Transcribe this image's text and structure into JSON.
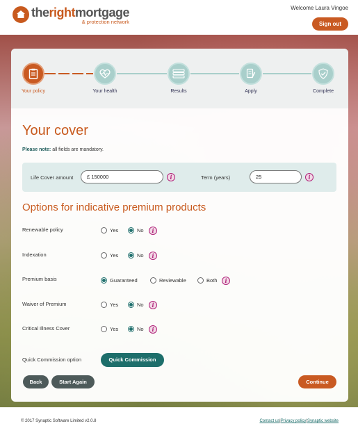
{
  "header": {
    "logo_the": "the",
    "logo_right": "right",
    "logo_mortgage": "mortgage",
    "logo_sub": "& protection network",
    "welcome": "Welcome Laura Vingoe",
    "signout": "Sign out"
  },
  "steps": [
    {
      "label": "Your policy",
      "icon": "clipboard-icon",
      "active": true
    },
    {
      "label": "Your health",
      "icon": "heart-pulse-icon",
      "active": false
    },
    {
      "label": "Results",
      "icon": "list-icon",
      "active": false
    },
    {
      "label": "Apply",
      "icon": "document-pen-icon",
      "active": false
    },
    {
      "label": "Complete",
      "icon": "shield-check-icon",
      "active": false
    }
  ],
  "cover": {
    "title": "Your cover",
    "note_bold": "Please note:",
    "note_text": " all fields are mandatory.",
    "life_cover_label": "Life Cover amount",
    "life_cover_value": "£ 150000",
    "term_label": "Term (years)",
    "term_value": "25"
  },
  "options": {
    "title": "Options for indicative premium products",
    "renewable": {
      "label": "Renewable policy",
      "yes": "Yes",
      "no": "No",
      "selected": "No"
    },
    "indexation": {
      "label": "Indexation",
      "yes": "Yes",
      "no": "No",
      "selected": "No"
    },
    "premium_basis": {
      "label": "Premium basis",
      "guaranteed": "Guaranteed",
      "reviewable": "Reviewable",
      "both": "Both",
      "selected": "Guaranteed"
    },
    "waiver": {
      "label": "Waiver of Premium",
      "yes": "Yes",
      "no": "No",
      "selected": "No"
    },
    "critical_illness": {
      "label": "Critical Illness Cover",
      "yes": "Yes",
      "no": "No",
      "selected": "No"
    },
    "quick_commission_label": "Quick Commission option",
    "quick_commission_button": "Quick Commission"
  },
  "actions": {
    "back": "Back",
    "start_again": "Start Again",
    "continue": "Continue"
  },
  "footer": {
    "copyright": "© 2017 Synaptic Software Limited v2.0.8",
    "contact": "Contact us",
    "privacy": "Privacy policy",
    "synaptic": "Synaptic website",
    "sep": "|"
  },
  "colors": {
    "accent": "#c95a22",
    "teal": "#1d6e6b",
    "info": "#b0247a"
  }
}
